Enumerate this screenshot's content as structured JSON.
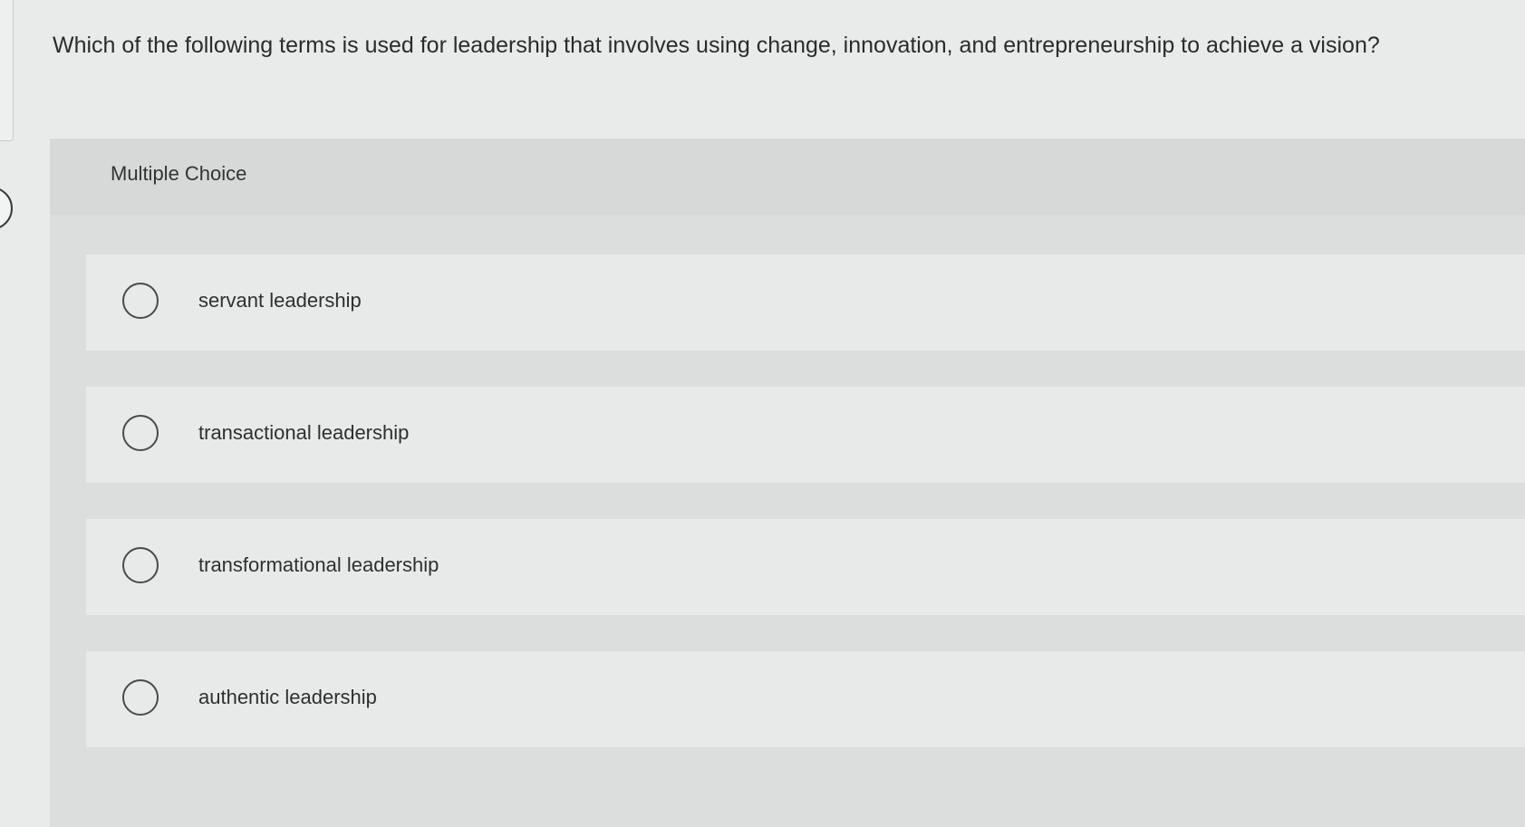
{
  "question": {
    "text": "Which of the following terms is used for leadership that involves using change, innovation, and entrepreneurship to achieve a vision?"
  },
  "panel": {
    "label": "Multiple Choice"
  },
  "options": [
    {
      "label": "servant leadership",
      "selected": false
    },
    {
      "label": "transactional leadership",
      "selected": false
    },
    {
      "label": "transformational leadership",
      "selected": false
    },
    {
      "label": "authentic leadership",
      "selected": false
    }
  ]
}
